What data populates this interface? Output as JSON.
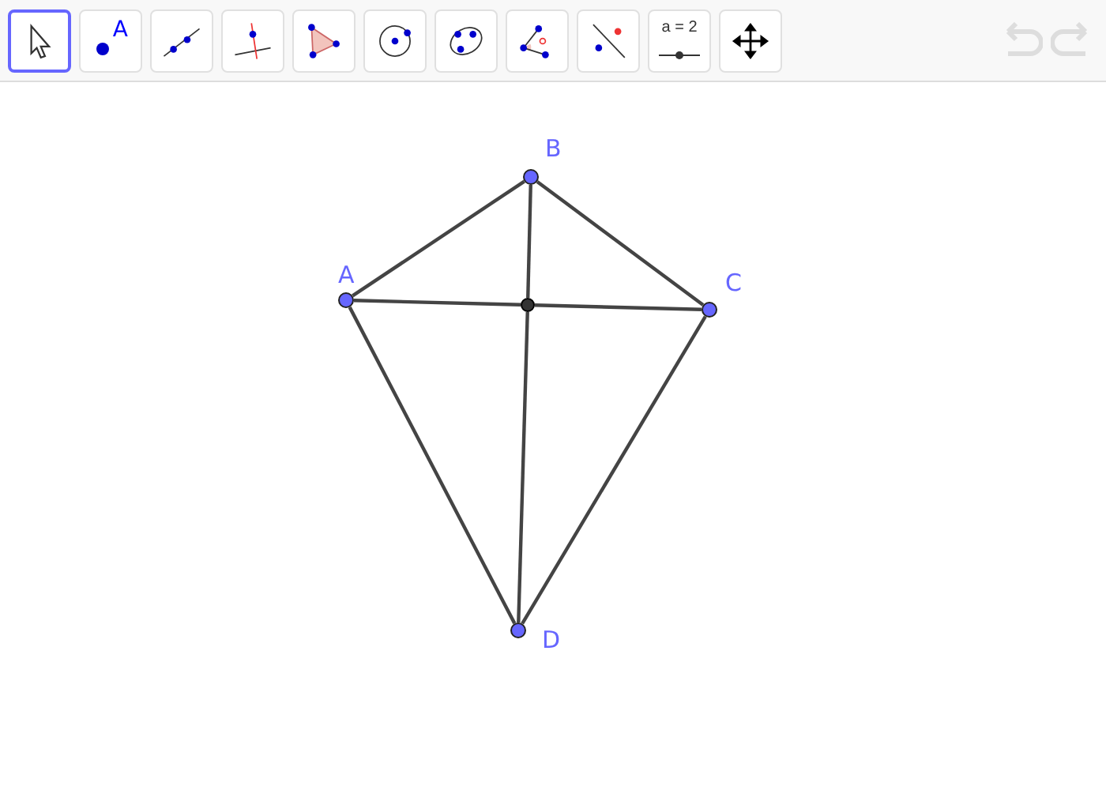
{
  "toolbar": {
    "tools": [
      {
        "kind": "move",
        "selected": true
      },
      {
        "kind": "point",
        "label": "A",
        "selected": false
      },
      {
        "kind": "line",
        "selected": false
      },
      {
        "kind": "perpendicular",
        "selected": false
      },
      {
        "kind": "polygon",
        "selected": false
      },
      {
        "kind": "circle",
        "selected": false
      },
      {
        "kind": "conic",
        "selected": false
      },
      {
        "kind": "angle",
        "selected": false
      },
      {
        "kind": "reflect",
        "selected": false
      },
      {
        "kind": "slider",
        "label": "a = 2",
        "selected": false
      },
      {
        "kind": "pan",
        "selected": false
      }
    ],
    "undo": {
      "disabled": true
    },
    "redo": {
      "disabled": true
    }
  },
  "points": [
    {
      "name": "A",
      "color": "#6666ff"
    },
    {
      "name": "B",
      "color": "#6666ff"
    },
    {
      "name": "C",
      "color": "#6666ff"
    },
    {
      "name": "D",
      "color": "#6666ff"
    }
  ],
  "intersection": {
    "color": "#333333"
  }
}
